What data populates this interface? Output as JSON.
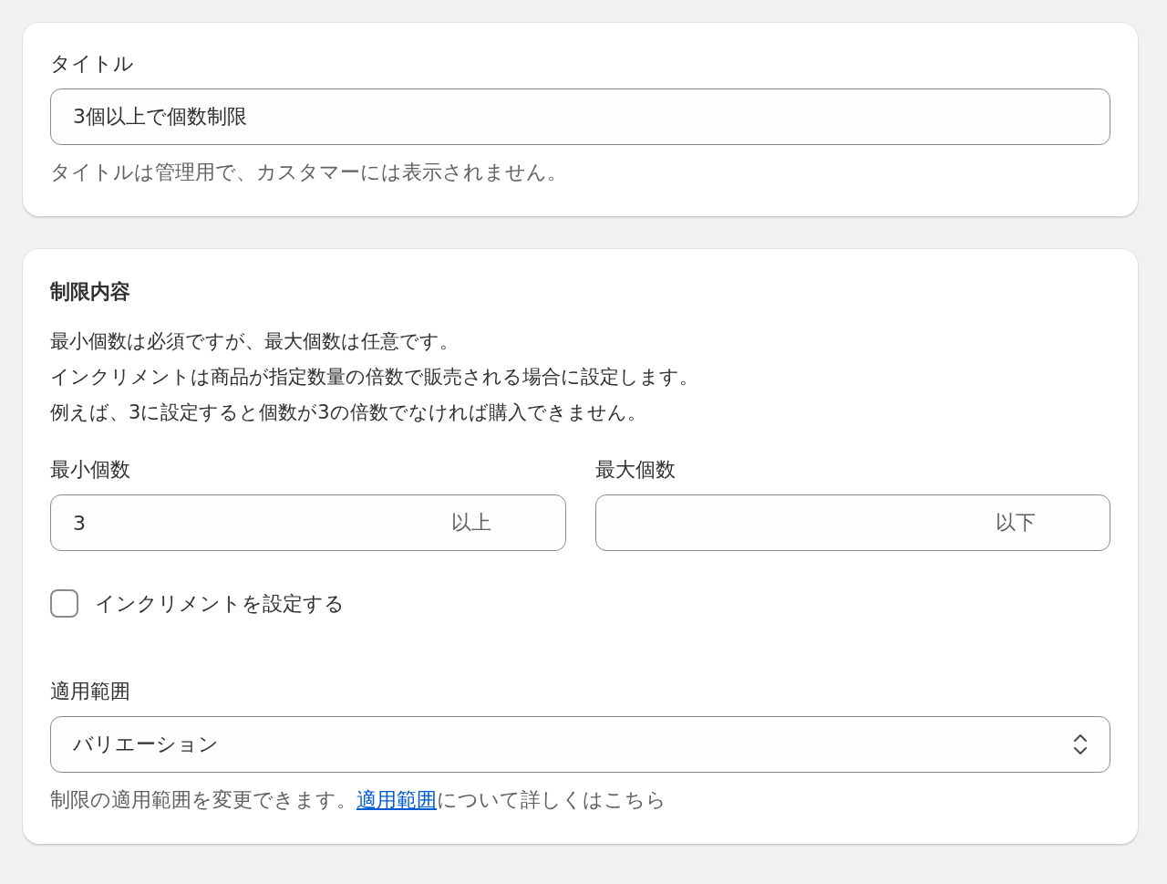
{
  "title_card": {
    "label": "タイトル",
    "value": "3個以上で個数制限",
    "help": "タイトルは管理用で、カスタマーには表示されません。"
  },
  "limits_card": {
    "heading": "制限内容",
    "description": [
      "最小個数は必須ですが、最大個数は任意です。",
      "インクリメントは商品が指定数量の倍数で販売される場合に設定します。",
      "例えば、3に設定すると個数が3の倍数でなければ購入できません。"
    ],
    "fields": [
      {
        "label": "最小個数",
        "value": "3",
        "suffix": "以上"
      },
      {
        "label": "最大個数",
        "suffix": "以下"
      }
    ],
    "increment": {
      "label": "インクリメントを設定する",
      "checked": false
    },
    "scope": {
      "label": "適用範囲",
      "value": "バリエーション",
      "help_before": "制限の適用範囲を変更できます。",
      "help_link": "適用範囲",
      "help_after": "について詳しくはこちら"
    }
  }
}
